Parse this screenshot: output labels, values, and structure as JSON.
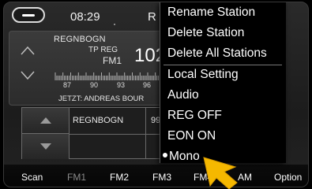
{
  "statusbar": {
    "time": "08:29",
    "status_letter": "R"
  },
  "radio": {
    "station_name": "REGNBOGN",
    "tp_reg": "TP REG",
    "band": "FM1",
    "frequency": "102",
    "scale_labels": [
      "87",
      "90",
      "93",
      "96"
    ],
    "radiotext": "JETZT: ANDREAS BOUR"
  },
  "presets": {
    "name": "REGNBOGN",
    "freq": "99"
  },
  "toolbar": {
    "scan": "Scan",
    "fm1": "FM1",
    "fm2": "FM2",
    "fm3": "FM3",
    "fm4": "FM4",
    "am": "AM",
    "option": "Option"
  },
  "menu": {
    "items": [
      {
        "label": "Rename Station"
      },
      {
        "label": "Delete Station"
      },
      {
        "label": "Delete All Stations"
      },
      {
        "label": "Local Setting"
      },
      {
        "label": "Audio"
      },
      {
        "label": "REG OFF"
      },
      {
        "label": "EON ON"
      },
      {
        "label": "Mono",
        "selected": true
      }
    ]
  },
  "colors": {
    "pointer": "#f5b800",
    "accent_text": "#ffffff",
    "dim_text": "#8a8a8a"
  },
  "icons": {
    "back": "minus-pill-icon",
    "up": "triangle-up-icon",
    "down": "triangle-down-icon",
    "pointer": "yellow-arrow-pointer-icon"
  }
}
